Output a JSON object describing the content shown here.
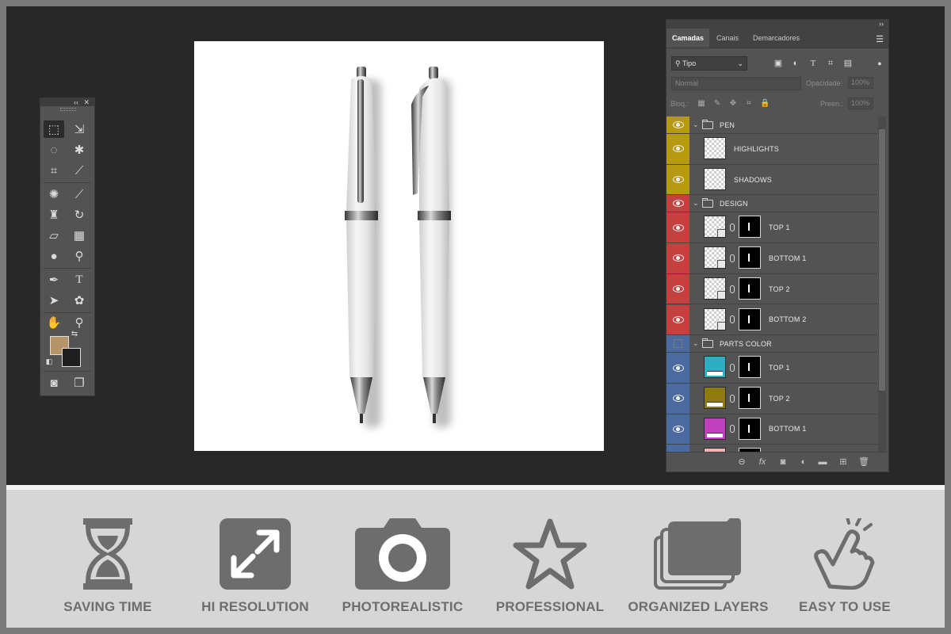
{
  "toolbox": {
    "collapse": "‹‹",
    "close": "✕",
    "fg_color": "#b49468",
    "bg_color": "#1e1e1e"
  },
  "layers_panel": {
    "collapse": "››",
    "tabs": [
      "Camadas",
      "Canais",
      "Demarcadores"
    ],
    "filter_label": "Tipo",
    "blend_mode": "Normal",
    "opacity_label": "Opacidade:",
    "opacity_value": "100%",
    "lock_label": "Bloq.:",
    "fill_label": "Preen.:",
    "fill_value": "100%",
    "layers": [
      {
        "name": "PEN",
        "kind": "group",
        "color": "#b59a12",
        "visible": true
      },
      {
        "name": "HIGHLIGHTS",
        "kind": "layer",
        "color": "#b59a12",
        "visible": true
      },
      {
        "name": "SHADOWS",
        "kind": "layer",
        "color": "#b59a12",
        "visible": true
      },
      {
        "name": "DESIGN",
        "kind": "group",
        "color": "#c64040",
        "visible": true
      },
      {
        "name": "TOP 1",
        "kind": "smart",
        "color": "#c64040",
        "visible": true
      },
      {
        "name": "BOTTOM 1",
        "kind": "smart",
        "color": "#c64040",
        "visible": true
      },
      {
        "name": "TOP  2",
        "kind": "smart",
        "color": "#c64040",
        "visible": true
      },
      {
        "name": "BOTTOM 2",
        "kind": "smart",
        "color": "#c64040",
        "visible": true
      },
      {
        "name": "PARTS COLOR",
        "kind": "group",
        "color": "#4a6aa0",
        "visible": false
      },
      {
        "name": "TOP 1",
        "kind": "fill",
        "color": "#4a6aa0",
        "fill": "#2ab0c0",
        "visible": true
      },
      {
        "name": "TOP 2",
        "kind": "fill",
        "color": "#4a6aa0",
        "fill": "#8f7a10",
        "visible": true
      },
      {
        "name": "BOTTOM 1",
        "kind": "fill",
        "color": "#4a6aa0",
        "fill": "#c040c0",
        "visible": true
      },
      {
        "name": "",
        "kind": "fill",
        "color": "#4a6aa0",
        "fill": "#f0b4b4",
        "visible": true
      }
    ]
  },
  "features": [
    {
      "label": "SAVING TIME",
      "icon": "hourglass-icon"
    },
    {
      "label": "HI RESOLUTION",
      "icon": "expand-arrows-icon"
    },
    {
      "label": "PHOTOREALISTIC",
      "icon": "camera-icon"
    },
    {
      "label": "PROFESSIONAL",
      "icon": "star-icon"
    },
    {
      "label": "ORGANIZED LAYERS",
      "icon": "stacked-layers-icon"
    },
    {
      "label": "EASY TO USE",
      "icon": "pointing-hand-icon"
    }
  ],
  "colors": {
    "workspace": "#282828",
    "panel": "#535353",
    "feature_bar": "#d6d6d6",
    "feature_icon": "#6d6d6d"
  }
}
